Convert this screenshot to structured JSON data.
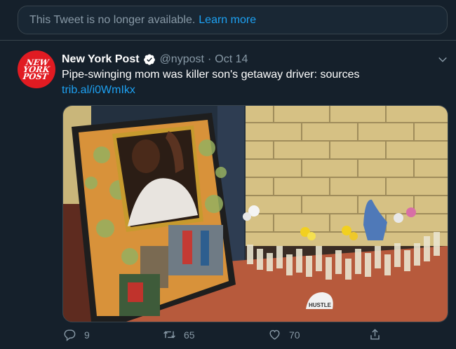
{
  "notice": {
    "text": "This Tweet is no longer available.",
    "link": "Learn more"
  },
  "tweet": {
    "avatar_text": "NEW\nYORK\nPOST",
    "author_name": "New York Post",
    "handle": "@nypost",
    "separator": "·",
    "date": "Oct 14",
    "text": "Pipe-swinging mom was killer son's getaway driver: sources",
    "link": "trib.al/i0WmIkx",
    "image_text": "HUSTLE",
    "replies": "9",
    "retweets": "65",
    "likes": "70"
  },
  "colors": {
    "background": "#15202b",
    "accent": "#1da1f2",
    "muted": "#8899a6",
    "border": "#38444d",
    "brand_red": "#e11b22"
  },
  "icons": [
    "caret-down-icon",
    "verified-badge-icon",
    "reply-icon",
    "retweet-icon",
    "like-icon",
    "share-icon"
  ]
}
